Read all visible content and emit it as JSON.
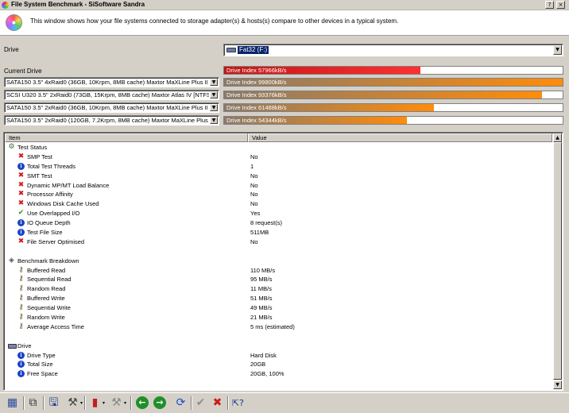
{
  "window": {
    "title": "File System Benchmark - SiSoftware Sandra",
    "controls": {
      "help": "?",
      "close": "×"
    }
  },
  "header": {
    "description": "This window shows how your file systems connected to storage adapter(s) & hosts(s) compare to other devices in a typical system."
  },
  "drive": {
    "label": "Drive",
    "selected": "Fat32 (F:)"
  },
  "current_drive": {
    "label": "Current Drive",
    "index_text": "Drive Index 57966kB/s",
    "fraction": 0.58,
    "colors": [
      "#c01818",
      "#ff3030"
    ]
  },
  "comparisons": [
    {
      "device": "SATA150 3.5\" 4xRaid0 (36GB, 10Krpm, 8MB cache) Maxtor MaXLine Plus II [",
      "index_text": "Drive Index 99800kB/s",
      "fraction": 1.0
    },
    {
      "device": "SCSI U320 3.5\" 2xRaid0 (73GB, 15Krpm, 8MB cache) Maxtor Atlas IV [NTFS,",
      "index_text": "Drive Index 93376kB/s",
      "fraction": 0.94
    },
    {
      "device": "SATA150 3.5\" 2xRaid0 (36GB, 10Krpm, 8MB cache) Maxtor MaXLine Plus II [",
      "index_text": "Drive Index 61488kB/s",
      "fraction": 0.62
    },
    {
      "device": "SATA150 3.5\" 2xRaid0 (120GB, 7.2Krpm, 8MB cache) Maxtor MaXLine Plus I",
      "index_text": "Drive Index 54344kB/s",
      "fraction": 0.54
    }
  ],
  "comparison_colors": [
    "#8a7a6a",
    "#ff8c0a"
  ],
  "list": {
    "columns": {
      "item": "Item",
      "value": "Value"
    },
    "rows": [
      {
        "type": "group",
        "icon": "gear-icon",
        "item": "Test Status",
        "value": ""
      },
      {
        "type": "item",
        "icon": "cross-icon",
        "item": "SMP Test",
        "value": "No"
      },
      {
        "type": "item",
        "icon": "info-icon",
        "item": "Total Test Threads",
        "value": "1"
      },
      {
        "type": "item",
        "icon": "cross-icon",
        "item": "SMT Test",
        "value": "No"
      },
      {
        "type": "item",
        "icon": "cross-icon",
        "item": "Dynamic MP/MT Load Balance",
        "value": "No"
      },
      {
        "type": "item",
        "icon": "cross-icon",
        "item": "Processor Affinity",
        "value": "No"
      },
      {
        "type": "item",
        "icon": "cross-icon",
        "item": "Windows Disk Cache Used",
        "value": "No"
      },
      {
        "type": "item",
        "icon": "check-icon",
        "item": "Use Overlapped I/O",
        "value": "Yes"
      },
      {
        "type": "item",
        "icon": "info-icon",
        "item": "IO Queue Depth",
        "value": "8 request(s)"
      },
      {
        "type": "item",
        "icon": "info-icon",
        "item": "Test File Size",
        "value": "511MB"
      },
      {
        "type": "item",
        "icon": "cross-icon",
        "item": "File Server Optimised",
        "value": "No"
      },
      {
        "type": "blank",
        "icon": "",
        "item": "",
        "value": ""
      },
      {
        "type": "group",
        "icon": "diamond-icon",
        "item": "Benchmark Breakdown",
        "value": ""
      },
      {
        "type": "item",
        "icon": "key-icon",
        "item": "Buffered Read",
        "value": "110 MB/s"
      },
      {
        "type": "item",
        "icon": "key-icon",
        "item": "Sequential Read",
        "value": "95 MB/s"
      },
      {
        "type": "item",
        "icon": "key-icon",
        "item": "Random Read",
        "value": "11 MB/s"
      },
      {
        "type": "item",
        "icon": "key-icon",
        "item": "Buffered Write",
        "value": "51 MB/s"
      },
      {
        "type": "item",
        "icon": "key-icon",
        "item": "Sequential Write",
        "value": "49 MB/s"
      },
      {
        "type": "item",
        "icon": "key-icon",
        "item": "Random Write",
        "value": "21 MB/s"
      },
      {
        "type": "item",
        "icon": "key-icon",
        "item": "Average Access Time",
        "value": "5 ms (estimated)"
      },
      {
        "type": "blank",
        "icon": "",
        "item": "",
        "value": ""
      },
      {
        "type": "group",
        "icon": "drive-icon",
        "item": "Drive",
        "value": ""
      },
      {
        "type": "item",
        "icon": "info-icon",
        "item": "Drive Type",
        "value": "Hard Disk"
      },
      {
        "type": "item",
        "icon": "info-icon",
        "item": "Total Size",
        "value": "20GB"
      },
      {
        "type": "item",
        "icon": "info-icon",
        "item": "Free Space",
        "value": "20GB, 100%"
      }
    ]
  },
  "toolbar": {
    "buttons": [
      {
        "name": "select-all-button",
        "glyph": "▦",
        "color": "#2a4a9a"
      },
      {
        "name": "copy-button",
        "glyph": "⧉",
        "color": "#333333"
      },
      {
        "name": "save-button",
        "glyph": "🖫",
        "color": "#1a3a8a"
      },
      {
        "name": "options-button",
        "glyph": "⚒",
        "color": "#444444"
      },
      {
        "name": "chart-button",
        "glyph": "▮",
        "color": "#c02020"
      },
      {
        "name": "tools-button",
        "glyph": "⚒",
        "color": "#888888"
      },
      {
        "name": "back-button",
        "glyph": "◀",
        "color": "#1f8f2a"
      },
      {
        "name": "forward-button",
        "glyph": "▶",
        "color": "#1f8f2a"
      },
      {
        "name": "refresh-button",
        "glyph": "⟳",
        "color": "#1a4ac8"
      },
      {
        "name": "ok-button",
        "glyph": "✔",
        "color": "#909090"
      },
      {
        "name": "cancel-button",
        "glyph": "✖",
        "color": "#d01818"
      },
      {
        "name": "help-button",
        "glyph": "⇱?",
        "color": "#1a3a8a"
      }
    ]
  }
}
